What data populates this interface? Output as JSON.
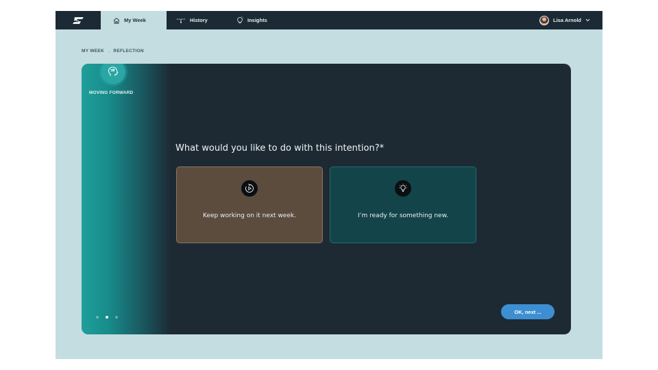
{
  "nav": {
    "tabs": [
      {
        "label": "My Week",
        "icon": "home-icon",
        "active": true
      },
      {
        "label": "History",
        "icon": "timeline-icon",
        "active": false
      },
      {
        "label": "Insights",
        "icon": "lightbulb-icon",
        "active": false
      }
    ],
    "user_name": "Lisa Arnold"
  },
  "breadcrumb": {
    "parent": "MY WEEK",
    "separator": "→",
    "current": "REFLECTION"
  },
  "sidebar": {
    "step_label": "MOVING FORWARD",
    "step_icon": "head-icon",
    "pagination": {
      "total": 3,
      "active_index": 1
    }
  },
  "main": {
    "question": "What would you like to do with this intention?*",
    "options": [
      {
        "text": "Keep working on it next week.",
        "icon": "replay-icon"
      },
      {
        "text": "I’m ready for something new.",
        "icon": "lightbulb-icon"
      }
    ],
    "next_label": "OK, next ..."
  },
  "colors": {
    "nav_bg": "#1c2a35",
    "page_bg": "#c4dde1",
    "card_bg": "#1d2a34",
    "accent_teal": "#1f9f9b",
    "option_keep_bg": "#5b4c3e",
    "option_new_bg": "#134449",
    "button_blue": "#3d8fd1"
  }
}
